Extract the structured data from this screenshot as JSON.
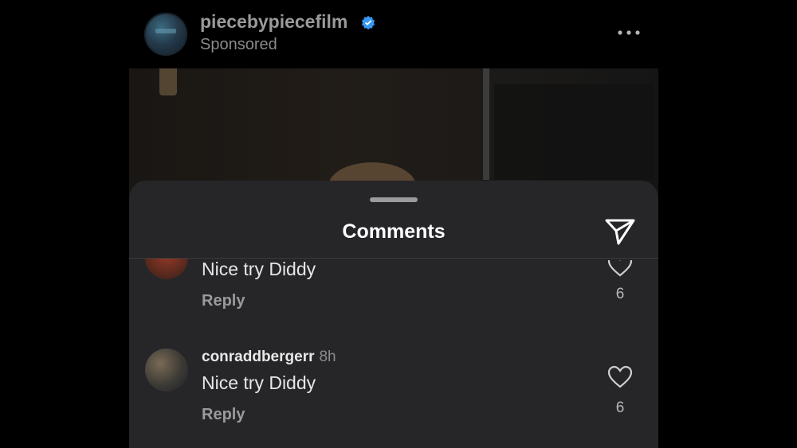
{
  "post": {
    "account": "piecebypiecefilm",
    "sponsored": "Sponsored"
  },
  "sheet": {
    "title": "Comments"
  },
  "comments": [
    {
      "username": "",
      "time": "",
      "text": "Nice try Diddy",
      "reply": "Reply",
      "likes": "6"
    },
    {
      "username": "conraddbergerr",
      "time": "8h",
      "text": "Nice try Diddy",
      "reply": "Reply",
      "likes": "6"
    }
  ],
  "colors": {
    "background": "#000000",
    "sheet": "#262629",
    "verified": "#3897f0",
    "text": "#e6e6e6",
    "muted": "#9a9a9e"
  },
  "icons": [
    "verified-badge-icon",
    "more-options-icon",
    "share-send-icon",
    "heart-icon"
  ]
}
